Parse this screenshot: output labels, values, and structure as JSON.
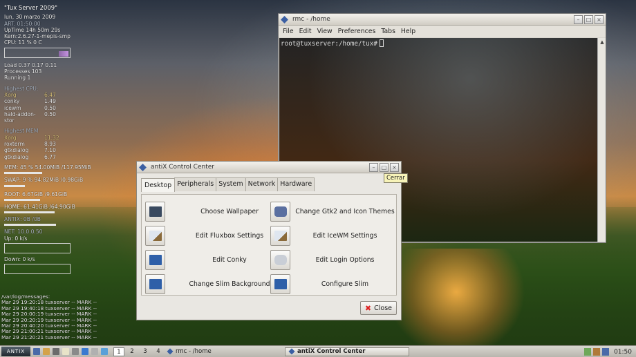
{
  "conky": {
    "title": "\"Tux Server 2009\"",
    "date": "lun,  30 marzo 2009",
    "art": "ART.    01:50:00",
    "uptime": "UpTime 14h 50m 29s",
    "kern": "Kern:2.6.27-1-mepis-smp",
    "cpu": "CPU: 11 % 0   C",
    "load": "Load  0.37 0.17 0.11",
    "processes": "Processes  103",
    "running": "Running   1",
    "highest_cpu_label": "Highest CPU:",
    "highest_cpu": [
      {
        "name": "Xorg",
        "value": "6.47"
      },
      {
        "name": "conky",
        "value": "1.49"
      },
      {
        "name": "icewm",
        "value": "0.50"
      },
      {
        "name": "hald-addon-stor",
        "value": "0.50"
      }
    ],
    "highest_mem_label": "Highest MEM",
    "highest_mem": [
      {
        "name": "Xorg",
        "value": "11.32"
      },
      {
        "name": "roxterm",
        "value": "8.93"
      },
      {
        "name": "gtkdialog",
        "value": "7.10"
      },
      {
        "name": "gtkdialog",
        "value": "6.77"
      }
    ],
    "mem": "MEM:  45 % 54.00MiB /117.95MiB",
    "swap": "SWAP: 9 % 94.82MiB /0.98GiB",
    "root": "ROOT:    6.67GiB  /9.61GiB",
    "home": "HOME:   61.41GiB /64.90GiB",
    "antix": "ANTIX:   0B      /0B",
    "net": "NET: 10.0.0.50",
    "up": "Up: 0    k/s",
    "down": "Down: 0    k/s",
    "log_header": "/var/log/messages:",
    "logs": [
      "Mar 29 19:20:18 tuxserver -- MARK --",
      "Mar 29 19:40:18 tuxserver -- MARK --",
      "Mar 29 20:00:19 tuxserver -- MARK --",
      "Mar 29 20:20:19 tuxserver -- MARK --",
      "Mar 29 20:40:20 tuxserver -- MARK --",
      "Mar 29 21:00:21 tuxserver -- MARK --",
      "Mar 29 21:20:21 tuxserver -- MARK --"
    ]
  },
  "terminal": {
    "title": "rmc - /home",
    "menu": [
      "File",
      "Edit",
      "View",
      "Preferences",
      "Tabs",
      "Help"
    ],
    "prompt": "root@tuxserver:/home/tux#"
  },
  "control_center": {
    "title": "antiX Control Center",
    "tabs": [
      "Desktop",
      "Peripherals",
      "System",
      "Network",
      "Hardware"
    ],
    "items": [
      {
        "label": "Choose Wallpaper",
        "icon": "monitor-icon",
        "color": "#3a4a60"
      },
      {
        "label": "Change Gtk2 and Icon Themes",
        "icon": "themes-icon",
        "color": "#5a6fa0"
      },
      {
        "label": "Edit Fluxbox Settings",
        "icon": "edit-window-icon",
        "color": "#8aa0c0"
      },
      {
        "label": "Edit IceWM Settings",
        "icon": "edit-window-icon",
        "color": "#8aa0c0"
      },
      {
        "label": "Edit Conky",
        "icon": "conky-icon",
        "color": "#2e5fa8"
      },
      {
        "label": "Edit Login Options",
        "icon": "login-icon",
        "color": "#c9ced6"
      },
      {
        "label": "Change Slim Background",
        "icon": "slim-icon",
        "color": "#2e5fa8"
      },
      {
        "label": "Configure Slim",
        "icon": "slim-icon",
        "color": "#2e5fa8"
      }
    ],
    "close_label": "Close",
    "tooltip": "Cerrar"
  },
  "taskbar": {
    "start_label": "ANTIX",
    "workspaces": [
      "1",
      "2",
      "3",
      "4"
    ],
    "tasks": [
      "rmc - /home",
      "antiX Control Center"
    ],
    "clock": "01:50"
  }
}
